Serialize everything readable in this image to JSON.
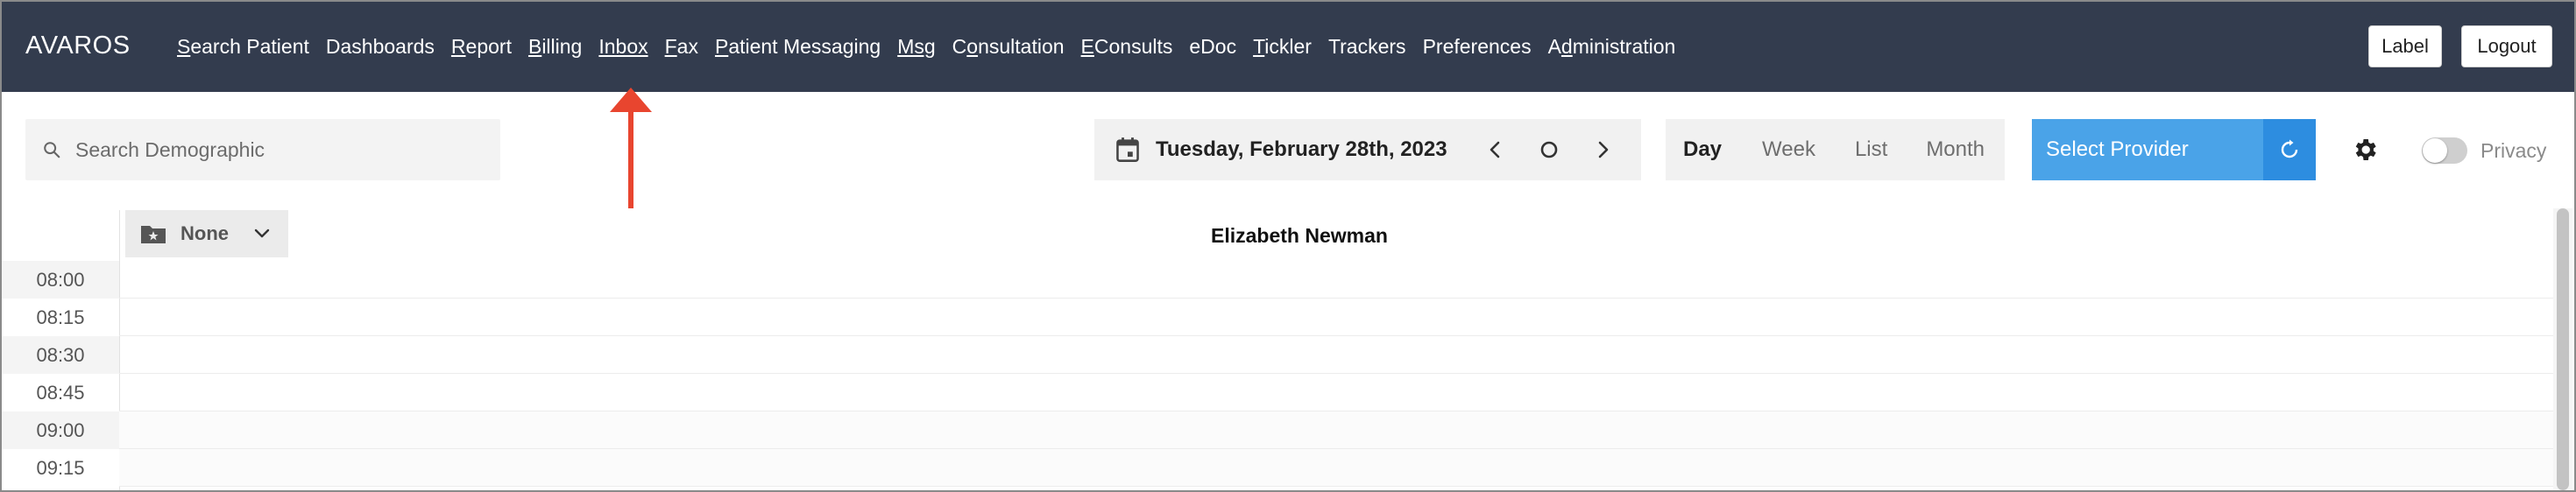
{
  "app": {
    "brand": "AVAROS"
  },
  "nav": {
    "items": [
      {
        "key": "search_patient",
        "pre": "",
        "ul": "S",
        "post": "earch Patient"
      },
      {
        "key": "dashboards",
        "pre": "",
        "ul": "",
        "post": "Dashboards"
      },
      {
        "key": "report",
        "pre": "",
        "ul": "R",
        "post": "eport"
      },
      {
        "key": "billing",
        "pre": "",
        "ul": "B",
        "post": "illing"
      },
      {
        "key": "inbox",
        "pre": "",
        "ul": "Inbox",
        "post": ""
      },
      {
        "key": "fax",
        "pre": "",
        "ul": "F",
        "post": "ax"
      },
      {
        "key": "patient_messaging",
        "pre": "",
        "ul": "P",
        "post": "atient Messaging"
      },
      {
        "key": "msg",
        "pre": "",
        "ul": "Msg",
        "post": ""
      },
      {
        "key": "consultation",
        "pre": "C",
        "ul": "o",
        "post": "nsultation"
      },
      {
        "key": "econsults",
        "pre": "",
        "ul": "E",
        "post": "Consults"
      },
      {
        "key": "edoc",
        "pre": "",
        "ul": "",
        "post": "eDoc"
      },
      {
        "key": "tickler",
        "pre": "",
        "ul": "T",
        "post": "ickler"
      },
      {
        "key": "trackers",
        "pre": "",
        "ul": "",
        "post": "Trackers"
      },
      {
        "key": "preferences",
        "pre": "",
        "ul": "",
        "post": "Preferences"
      },
      {
        "key": "administration",
        "pre": "A",
        "ul": "d",
        "post": "ministration"
      }
    ],
    "label_button": "Label",
    "logout_button": "Logout"
  },
  "toolbar": {
    "search_placeholder": "Search Demographic",
    "date": "Tuesday, February 28th, 2023",
    "views": [
      "Day",
      "Week",
      "List",
      "Month"
    ],
    "active_view": "Day",
    "provider_button": "Select Provider",
    "privacy_label": "Privacy",
    "privacy_on": false
  },
  "schedule": {
    "group_label": "None",
    "provider_name": "Elizabeth Newman",
    "times": [
      "08:00",
      "08:15",
      "08:30",
      "08:45",
      "09:00",
      "09:15"
    ]
  },
  "colors": {
    "topbar": "#333c4e",
    "provider_button": "#4aa3e8",
    "refresh_button": "#2d8de0",
    "annotation_arrow": "#e8452f"
  }
}
